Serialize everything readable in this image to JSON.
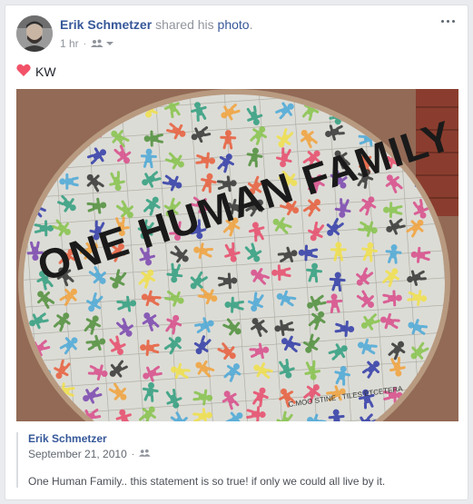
{
  "post": {
    "author": "Erik Schmetzer",
    "action_prefix": "shared his",
    "action_link": "photo",
    "action_suffix": ".",
    "time": "1 hr",
    "audience_icon": "friends-icon",
    "text": "KW",
    "emoji_icon": "heart-icon",
    "menu_icon": "more-options-icon"
  },
  "photo": {
    "painted_text": "ONE HUMAN FAMILY",
    "signature": "C.MOO STINE · TILES ETCETERA"
  },
  "shared": {
    "author": "Erik Schmetzer",
    "date": "September 21, 2010",
    "audience_icon": "friends-icon",
    "caption": "One Human Family.. this statement is so true! if only we could all live by it."
  },
  "colors": {
    "link": "#365899",
    "muted": "#90949c",
    "heart": "#f25268"
  }
}
